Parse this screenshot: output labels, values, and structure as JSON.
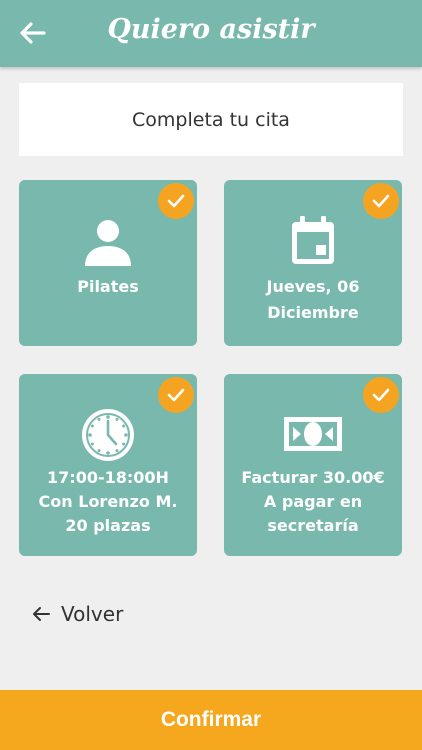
{
  "header": {
    "title": "Quiero asistir"
  },
  "intro": {
    "text": "Completa tu cita"
  },
  "cards": [
    {
      "lines": [
        "Pilates"
      ],
      "icon": "person-icon"
    },
    {
      "lines": [
        "Jueves, 06",
        "Diciembre"
      ],
      "icon": "calendar-icon"
    },
    {
      "lines": [
        "17:00-18:00H",
        "Con Lorenzo M.",
        "20 plazas"
      ],
      "icon": "clock-icon"
    },
    {
      "lines": [
        "Facturar 30.00€",
        "A pagar en",
        "secretaría"
      ],
      "icon": "cash-icon"
    }
  ],
  "back_link": {
    "label": "Volver"
  },
  "confirm_button": {
    "label": "Confirmar"
  },
  "colors": {
    "primary": "#79b8ad",
    "accent": "#f5a422",
    "background": "#efefef"
  }
}
